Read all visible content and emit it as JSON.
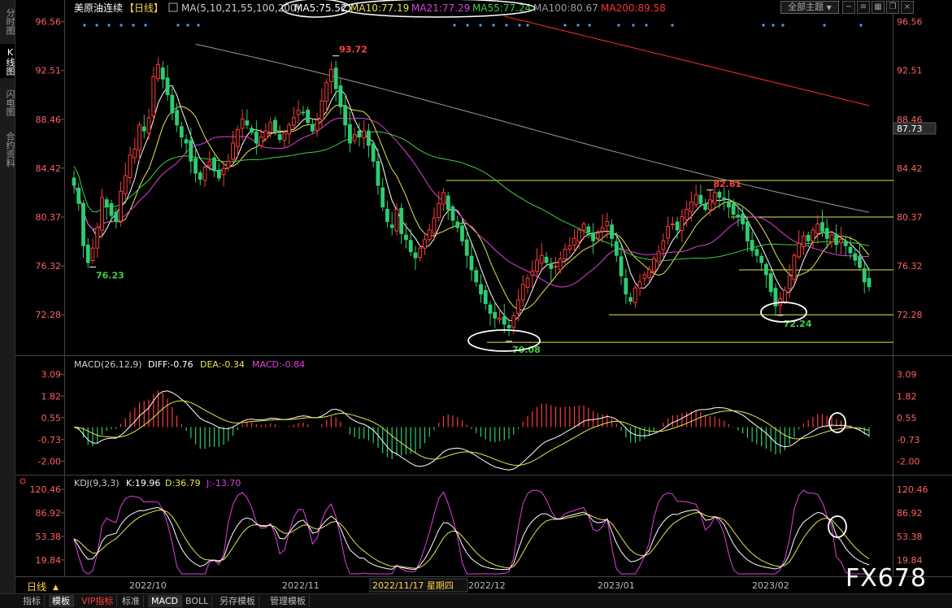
{
  "sidebar": {
    "tabs": [
      {
        "label": "分时图",
        "active": false
      },
      {
        "label": "K线图",
        "active": true
      },
      {
        "label": "闪电图",
        "active": false
      },
      {
        "label": "合约资料",
        "active": false
      }
    ]
  },
  "header": {
    "title": "美原油连续",
    "period_tag": "【日线】",
    "ma_params": "MA(5,10,21,55,100,200)",
    "ma_values": [
      {
        "label": "MA5:75.52",
        "color": "#ffffff"
      },
      {
        "label": "MA10:77.19",
        "color": "#e6e64c"
      },
      {
        "label": "MA21:77.29",
        "color": "#e040e0"
      },
      {
        "label": "MA55:77.24",
        "color": "#3fcf3f"
      },
      {
        "label": "MA100:80.67",
        "color": "#9a9a9a"
      },
      {
        "label": "MA200:89.58",
        "color": "#ff3030"
      }
    ],
    "theme_button": "全部主题",
    "theme_arrow": "▼",
    "toolbar_icons": [
      "minus-icon",
      "list-icon",
      "grid-icon",
      "restore-icon",
      "close-icon"
    ]
  },
  "chart_data": [
    {
      "type": "candlestick",
      "name": "price",
      "y_axis_ticks": [
        "96.56",
        "92.51",
        "88.46",
        "84.42",
        "80.37",
        "76.32",
        "72.28"
      ],
      "current_price": "87.73",
      "ylim": [
        69.4,
        97.0
      ],
      "annotations": [
        {
          "text": "93.72",
          "value": 93.72,
          "index": 56,
          "color": "#ff4040"
        },
        {
          "text": "76.23",
          "value": 76.23,
          "index": 4,
          "color": "#3fcf3f"
        },
        {
          "text": "70.08",
          "value": 70.08,
          "index": 93,
          "color": "#3fcf3f"
        },
        {
          "text": "82.61",
          "value": 82.61,
          "index": 136,
          "color": "#ff4040"
        },
        {
          "text": "72.24",
          "value": 72.24,
          "index": 151,
          "color": "#3fcf3f"
        }
      ],
      "horizontal_lines": [
        83.4,
        80.37,
        76.0,
        72.28,
        70.0
      ],
      "colors": {
        "up": "#ff3b3b",
        "down": "#2ecc71",
        "ma5": "#ffffff",
        "ma10": "#e6e64c",
        "ma21": "#e040e0",
        "ma55": "#3fcf3f",
        "ma100": "#9a9a9a",
        "ma200": "#ff3030"
      },
      "closes": [
        83.0,
        81.5,
        78.0,
        76.6,
        77.8,
        79.5,
        82.0,
        81.2,
        80.5,
        80.0,
        82.5,
        83.8,
        85.5,
        86.0,
        88.0,
        87.5,
        88.6,
        92.0,
        93.0,
        91.8,
        90.5,
        89.0,
        88.0,
        87.0,
        86.5,
        85.0,
        84.0,
        83.5,
        84.5,
        85.0,
        84.2,
        83.6,
        84.4,
        85.0,
        86.5,
        87.6,
        88.5,
        88.0,
        87.4,
        86.5,
        87.0,
        87.5,
        88.2,
        87.5,
        86.8,
        87.3,
        88.0,
        88.6,
        89.2,
        89.0,
        88.2,
        87.5,
        88.4,
        90.0,
        91.5,
        92.6,
        91.0,
        89.5,
        88.0,
        86.5,
        87.2,
        87.0,
        87.5,
        86.3,
        85.0,
        83.0,
        81.2,
        80.0,
        79.5,
        81.0,
        79.0,
        78.5,
        77.5,
        77.0,
        77.8,
        78.5,
        79.3,
        80.3,
        81.5,
        82.4,
        81.0,
        80.1,
        79.5,
        78.4,
        77.2,
        76.0,
        75.0,
        74.0,
        73.2,
        72.4,
        72.0,
        72.0,
        71.5,
        71.2,
        72.2,
        73.5,
        74.8,
        75.3,
        75.9,
        76.8,
        77.2,
        76.6,
        76.1,
        76.3,
        76.9,
        77.7,
        78.0,
        78.6,
        79.3,
        79.8,
        79.1,
        78.4,
        79.0,
        79.5,
        80.0,
        78.6,
        77.2,
        75.5,
        74.0,
        73.4,
        74.5,
        75.0,
        75.6,
        76.0,
        76.9,
        77.5,
        78.4,
        79.6,
        79.8,
        79.3,
        80.4,
        81.0,
        81.6,
        82.2,
        81.5,
        81.0,
        81.8,
        82.4,
        82.0,
        81.8,
        81.2,
        80.6,
        80.4,
        79.8,
        78.4,
        77.6,
        77.2,
        76.6,
        75.6,
        74.2,
        73.0,
        73.6,
        74.3,
        75.5,
        77.2,
        78.2,
        78.8,
        78.4,
        79.3,
        79.8,
        79.2,
        78.6,
        78.9,
        78.1,
        78.5,
        78.0,
        77.4,
        76.8,
        76.2,
        75.0,
        74.6
      ]
    },
    {
      "type": "bar+line",
      "name": "macd",
      "legend": [
        {
          "label": "MACD(26,12,9)",
          "color": "#cccccc"
        },
        {
          "label": "DIFF:-0.76",
          "color": "#ffffff"
        },
        {
          "label": "DEA:-0.34",
          "color": "#e6e64c"
        },
        {
          "label": "MACD:-0.84",
          "color": "#e040e0"
        }
      ],
      "y_axis_ticks": [
        "3.09",
        "1.82",
        "0.55",
        "-0.73",
        "-2.00"
      ],
      "ylim": [
        -2.6,
        3.5
      ]
    },
    {
      "type": "line",
      "name": "kdj",
      "legend": [
        {
          "label": "KDJ(9,3,3)",
          "color": "#cccccc"
        },
        {
          "label": "K:19.96",
          "color": "#ffffff"
        },
        {
          "label": "D:36.79",
          "color": "#e6e64c"
        },
        {
          "label": "J:-13.70",
          "color": "#e040e0"
        }
      ],
      "y_axis_ticks": [
        "120.46",
        "86.92",
        "53.38",
        "19.84"
      ],
      "ylim": [
        0,
        125
      ]
    }
  ],
  "time_axis": {
    "period_button": "日线",
    "period_arrow": "▲",
    "labels": [
      "2022/10",
      "2022/11",
      "2022/12",
      "2023/01",
      "2023/02"
    ],
    "cursor_date": "2022/11/17 星期四"
  },
  "bottom_tabs": [
    {
      "label": "指标",
      "active": false,
      "vip": false
    },
    {
      "label": "模板",
      "active": true,
      "vip": false
    },
    {
      "label": "VIP指标",
      "active": false,
      "vip": true
    },
    {
      "label": "标准",
      "active": false,
      "vip": false
    },
    {
      "label": "MACD",
      "active": true,
      "vip": false
    },
    {
      "label": "BOLL",
      "active": false,
      "vip": false
    },
    {
      "label": "另存模板",
      "active": false,
      "vip": false
    },
    {
      "label": "管理模板",
      "active": false,
      "vip": false
    }
  ],
  "watermark": "FX678"
}
